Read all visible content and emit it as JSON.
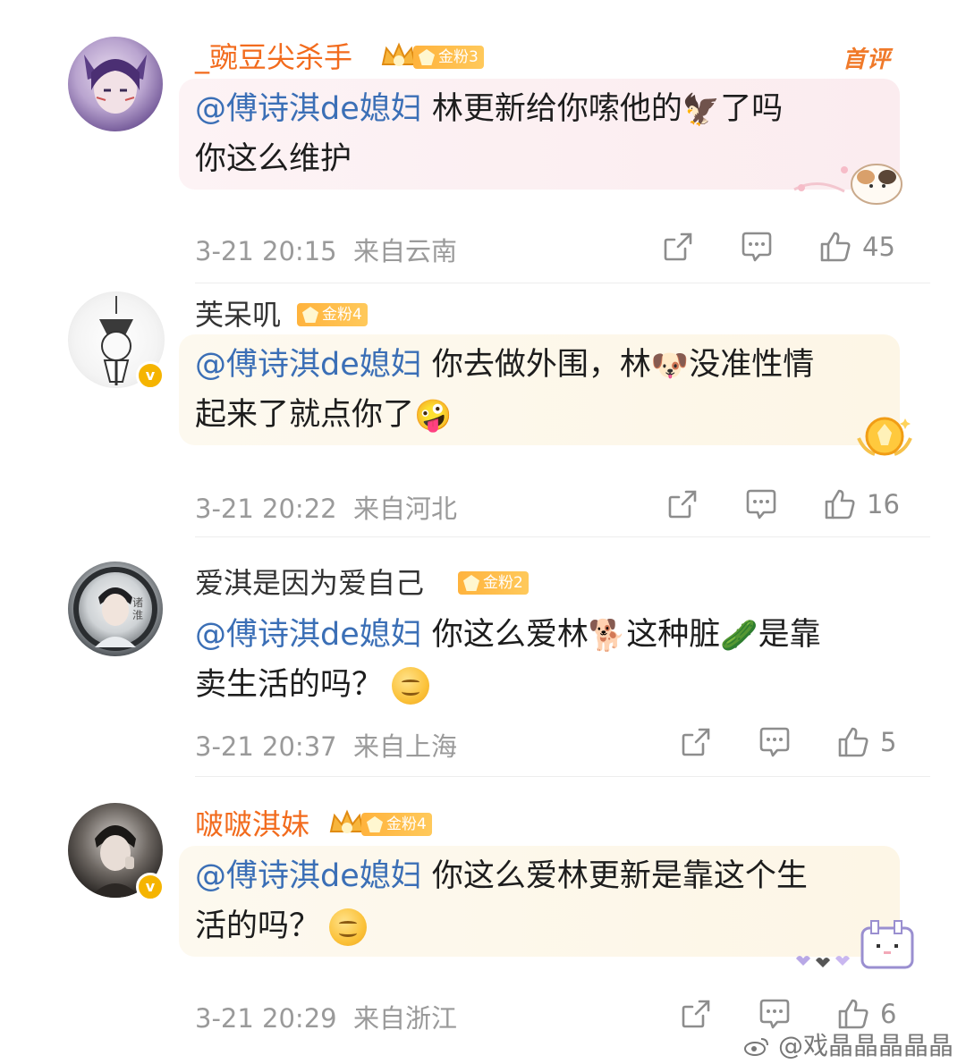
{
  "comments": [
    {
      "username": "_豌豆尖杀手",
      "badge": "金粉3",
      "first_tag": "首评",
      "mention": "@傅诗淇de媳妇",
      "text_a": "  林更新给你嗦他的",
      "text_b": "了吗",
      "text_c": "你这么维护",
      "emoji_1": "🦅",
      "time": "3-21 20:15",
      "location": "来自云南",
      "likes": "45"
    },
    {
      "username": "芙呆叽",
      "badge": "金粉4",
      "mention": "@傅诗淇de媳妇",
      "text_a": "  你去做外围，林",
      "text_b": "没准性情",
      "text_c": "起来了就点你了",
      "emoji_1": "🐶",
      "emoji_2": "🤪",
      "time": "3-21 20:22",
      "location": "来自河北",
      "likes": "16"
    },
    {
      "username": "爱淇是因为爱自己",
      "badge": "金粉2",
      "mention": "@傅诗淇de媳妇",
      "text_a": " 你这么爱林",
      "text_b": "这种脏",
      "text_c": "是靠",
      "text_d": "卖生活的吗？",
      "emoji_1": "🐕",
      "emoji_2": "🥒",
      "time": "3-21 20:37",
      "location": "来自上海",
      "likes": "5"
    },
    {
      "username": "啵啵淇妹",
      "badge": "金粉4",
      "mention": "@傅诗淇de媳妇",
      "text_a": " 你这么爱林更新是靠这个生",
      "text_b": "活的吗？",
      "time": "3-21 20:29",
      "location": "来自浙江",
      "likes": "6"
    }
  ],
  "icons": {
    "share": "share-icon",
    "comment": "comment-icon",
    "like": "thumbs-up-icon",
    "verified": "verified-icon"
  },
  "watermark": "@戏晶晶晶晶晶",
  "colors": {
    "mention": "#3b6fb6",
    "vip_name": "#f26b1d",
    "badge": "#ffb33d",
    "meta": "#9a9a9a"
  }
}
